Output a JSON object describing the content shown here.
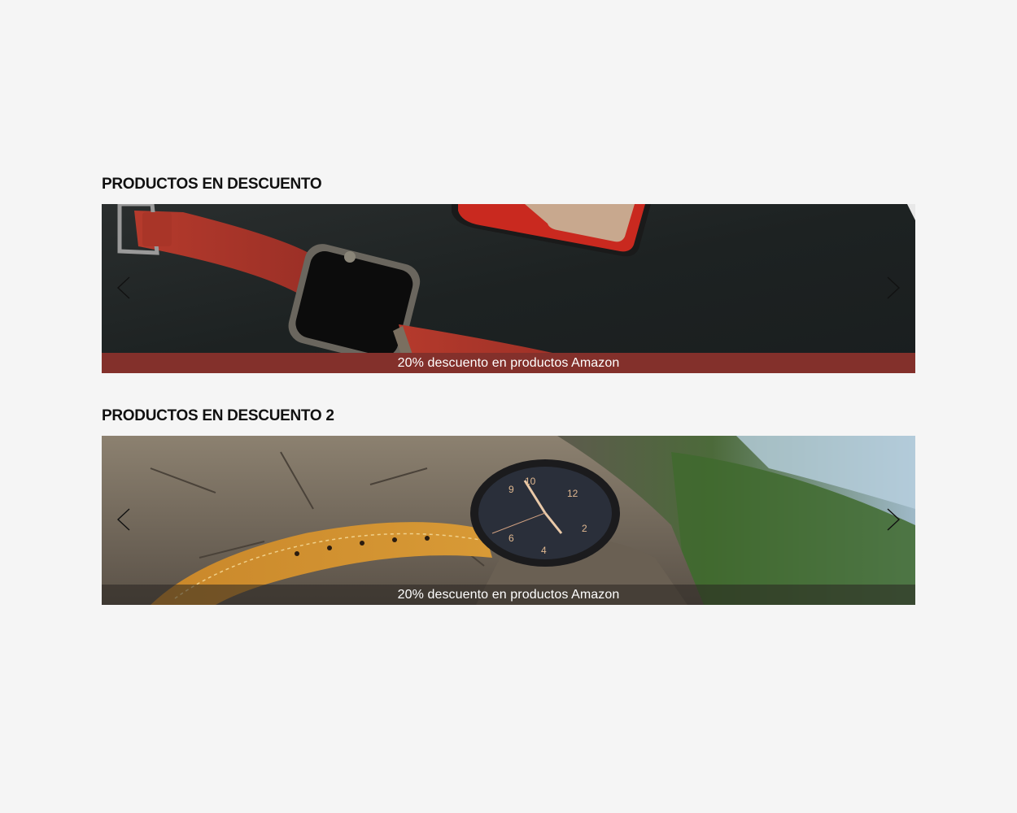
{
  "sections": [
    {
      "title": "PRODUCTOS EN DESCUENTO",
      "slide": {
        "image_icon": "smartwatch-red-strap-image",
        "caption": "20% descuento en productos Amazon",
        "caption_bg": "#83302b"
      }
    },
    {
      "title": "PRODUCTOS EN DESCUENTO 2",
      "slide": {
        "image_icon": "wristwatch-on-rock-image",
        "caption": "20% descuento en productos Amazon",
        "caption_bg": "#3a3632"
      }
    }
  ],
  "icons": {
    "prev": "chevron-left-icon",
    "next": "chevron-right-icon"
  }
}
